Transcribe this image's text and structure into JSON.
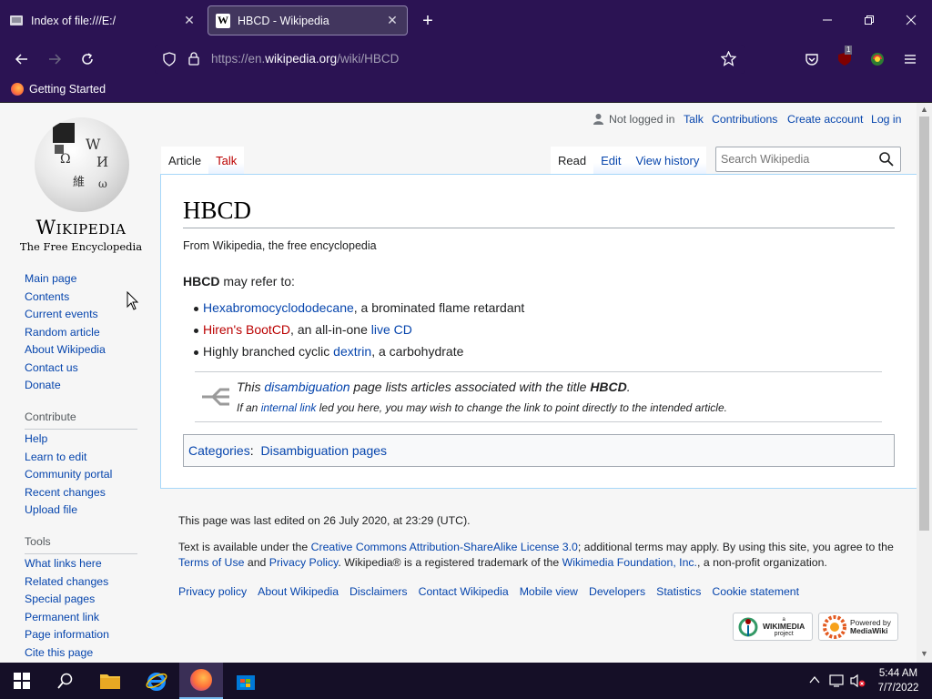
{
  "browser": {
    "tabs": [
      {
        "title": "Index of file:///E:/",
        "active": false
      },
      {
        "title": "HBCD - Wikipedia",
        "active": true
      }
    ],
    "url_prefix": "https://en.",
    "url_host": "wikipedia.org",
    "url_path": "/wiki/HBCD",
    "extension_badge": "1",
    "bookmark": "Getting Started"
  },
  "wiki": {
    "wordmark": "Wikipedia",
    "tagline": "The Free Encyclopedia",
    "globe_glyphs": [
      "Ω",
      "W",
      "И",
      "維",
      "ω"
    ],
    "nav": [
      "Main page",
      "Contents",
      "Current events",
      "Random article",
      "About Wikipedia",
      "Contact us",
      "Donate"
    ],
    "contribute_head": "Contribute",
    "contribute": [
      "Help",
      "Learn to edit",
      "Community portal",
      "Recent changes",
      "Upload file"
    ],
    "tools_head": "Tools",
    "tools": [
      "What links here",
      "Related changes",
      "Special pages",
      "Permanent link",
      "Page information",
      "Cite this page"
    ],
    "personal": {
      "not_logged": "Not logged in",
      "talk": "Talk",
      "contributions": "Contributions",
      "create_account": "Create account",
      "login": "Log in"
    },
    "tab_article": "Article",
    "tab_talk": "Talk",
    "tab_read": "Read",
    "tab_edit": "Edit",
    "tab_history": "View history",
    "search_placeholder": "Search Wikipedia",
    "title": "HBCD",
    "sitesub": "From Wikipedia, the free encyclopedia",
    "lead_bold": "HBCD",
    "lead_rest": " may refer to:",
    "items": [
      {
        "link": "Hexabromocyclododecane",
        "rest": ", a brominated flame retardant"
      },
      {
        "link_red": "Hiren's BootCD",
        "mid": ", an all-in-one ",
        "link2": "live CD"
      },
      {
        "pre": "Highly branched cyclic ",
        "link": "dextrin",
        "rest": ", a carbohydrate"
      }
    ],
    "dab_this": "This ",
    "dab_link": "disambiguation",
    "dab_mid": " page lists articles associated with the title ",
    "dab_title": "HBCD",
    "dab_end": ".",
    "dab2_pre": "If an ",
    "dab2_link": "internal link",
    "dab2_rest": " led you here, you may wish to change the link to point directly to the intended article.",
    "categories_label": "Categories",
    "categories_sep": ": ",
    "category": "Disambiguation pages",
    "footer_edited": "This page was last edited on 26 July 2020, at 23:29 (UTC).",
    "footer_text1_pre": "Text is available under the ",
    "footer_license": "Creative Commons Attribution-ShareAlike License 3.0",
    "footer_text1_post": "; additional terms may apply. By using this site, you agree to the",
    "footer_terms": "Terms of Use",
    "footer_and": " and ",
    "footer_privacy": "Privacy Policy",
    "footer_text2": ". Wikipedia® is a registered trademark of the ",
    "footer_foundation": "Wikimedia Foundation, Inc.",
    "footer_text3": ", a non-profit organization.",
    "footer_links": [
      "Privacy policy",
      "About Wikipedia",
      "Disclaimers",
      "Contact Wikipedia",
      "Mobile view",
      "Developers",
      "Statistics",
      "Cookie statement"
    ],
    "badge_wikimedia": [
      "a",
      "WIKIMEDIA",
      "project"
    ],
    "badge_mediawiki": [
      "Powered by",
      "MediaWiki"
    ]
  },
  "taskbar": {
    "time": "5:44 AM",
    "date": "7/7/2022"
  }
}
